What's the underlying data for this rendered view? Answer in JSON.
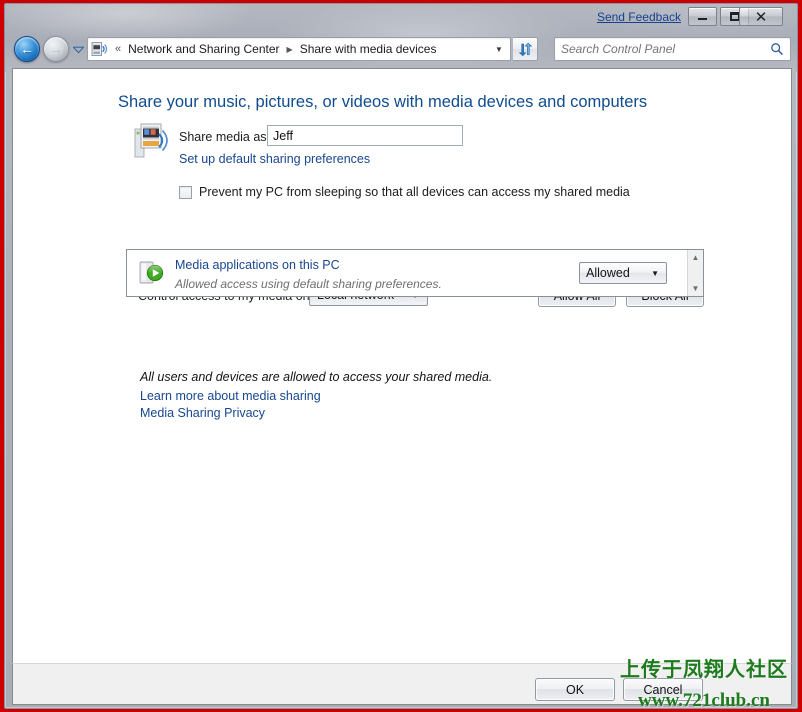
{
  "titlebar": {
    "feedback_label": "Send Feedback",
    "minimize_label": "Minimize",
    "maximize_label": "Maximize",
    "close_label": "Close",
    "close_glyph": "✕"
  },
  "navbar": {
    "back_glyph": "←",
    "forward_glyph": "→",
    "history_glyph": "▼",
    "breadcrumb": {
      "overflow": "«",
      "items": [
        {
          "label": "Network and Sharing Center"
        },
        {
          "label": "Share with media devices"
        }
      ],
      "separator": "▶"
    },
    "address_chevron": "▼",
    "refresh_label": "Refresh",
    "search": {
      "placeholder": "Search Control Panel",
      "value": ""
    }
  },
  "main": {
    "page_title": "Share your music, pictures, or videos with media devices and computers",
    "share_media_as_label": "Share media as:",
    "share_media_as_value": "Jeff",
    "share_media_as_placeholder": "",
    "default_prefs_link": "Set up default sharing preferences",
    "prevent_sleep_label": "Prevent my PC from sleeping so that all devices can access my shared media",
    "prevent_sleep_checked": false,
    "control_access_label": "Control access to my media on:",
    "network_scope_value": "Local network",
    "network_scope_arrow": "▼",
    "allow_all_label": "Allow All",
    "block_all_label": "Block All",
    "device_list": [
      {
        "name": "Media applications on this PC",
        "status": "Allowed access using default sharing preferences.",
        "permission": "Allowed"
      }
    ],
    "permission_arrow": "▼",
    "scroll_up_glyph": "▲",
    "scroll_down_glyph": "▼",
    "all_allowed_note": "All users and devices are allowed to access your shared media.",
    "learn_more_link": "Learn more about media sharing",
    "privacy_link": "Media Sharing Privacy"
  },
  "footer": {
    "ok_label": "OK",
    "cancel_label": "Cancel"
  },
  "watermark": {
    "line1": "上传于凤翔人社区",
    "line2": "www.721club.cn"
  },
  "colors": {
    "accent_link": "#17478f",
    "title_blue": "#0f4c8f",
    "window_border_red": "#cc0000",
    "watermark_green": "#1d7a1d"
  }
}
